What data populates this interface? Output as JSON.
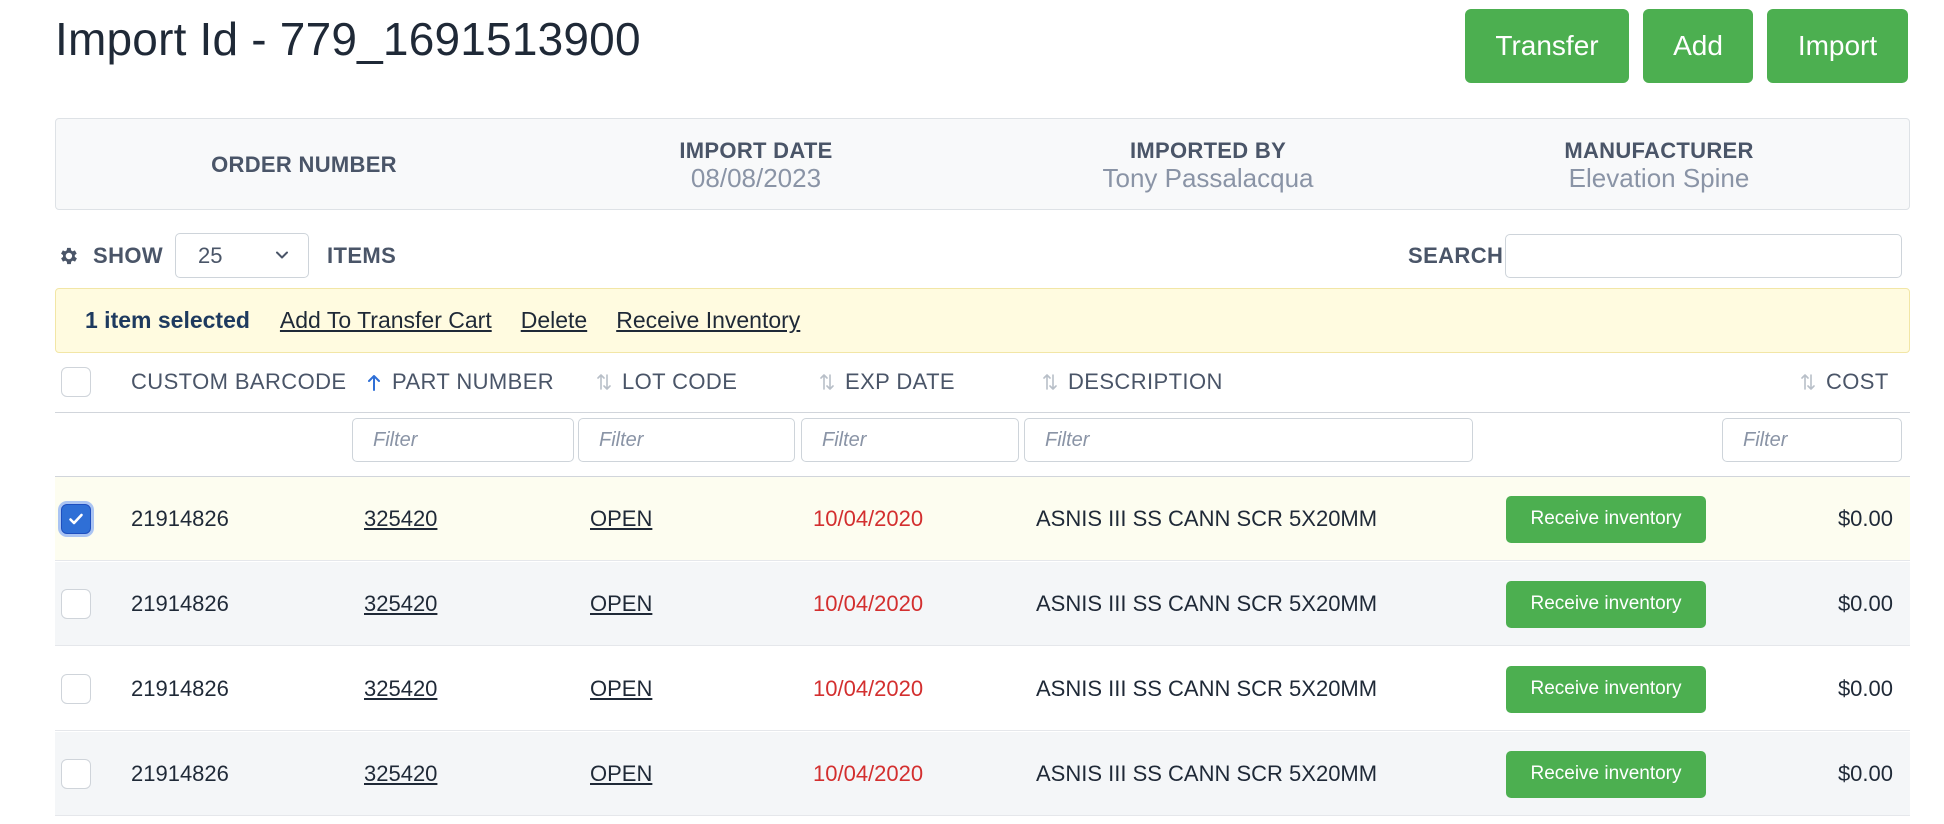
{
  "page_title": "Import Id - 779_1691513900",
  "header_buttons": {
    "transfer": "Transfer",
    "add": "Add",
    "import": "Import"
  },
  "info": {
    "order_number_label": "ORDER NUMBER",
    "import_date_label": "IMPORT DATE",
    "import_date_value": "08/08/2023",
    "imported_by_label": "IMPORTED BY",
    "imported_by_value": "Tony Passalacqua",
    "manufacturer_label": "MANUFACTURER",
    "manufacturer_value": "Elevation Spine"
  },
  "controls": {
    "show_label": "SHOW",
    "page_size": "25",
    "items_label": "ITEMS",
    "search_label": "SEARCH",
    "search_value": ""
  },
  "selection_bar": {
    "count_text": "1 item selected",
    "actions": [
      "Add To Transfer Cart",
      "Delete",
      "Receive Inventory"
    ]
  },
  "columns": {
    "custom_barcode": "CUSTOM BARCODE",
    "part_number": "PART NUMBER",
    "lot_code": "LOT CODE",
    "exp_date": "EXP DATE",
    "description": "DESCRIPTION",
    "cost": "COST"
  },
  "filter_placeholder": "Filter",
  "rows": [
    {
      "barcode": "21914826",
      "part": "325420",
      "lot": "OPEN",
      "exp": "10/04/2020",
      "desc": "ASNIS III SS CANN SCR 5X20MM",
      "action": "Receive inventory",
      "cost": "$0.00",
      "checked": true
    },
    {
      "barcode": "21914826",
      "part": "325420",
      "lot": "OPEN",
      "exp": "10/04/2020",
      "desc": "ASNIS III SS CANN SCR 5X20MM",
      "action": "Receive inventory",
      "cost": "$0.00",
      "checked": false
    },
    {
      "barcode": "21914826",
      "part": "325420",
      "lot": "OPEN",
      "exp": "10/04/2020",
      "desc": "ASNIS III SS CANN SCR 5X20MM",
      "action": "Receive inventory",
      "cost": "$0.00",
      "checked": false
    },
    {
      "barcode": "21914826",
      "part": "325420",
      "lot": "OPEN",
      "exp": "10/04/2020",
      "desc": "ASNIS III SS CANN SCR 5X20MM",
      "action": "Receive inventory",
      "cost": "$0.00",
      "checked": false
    }
  ],
  "colors": {
    "primary_green": "#4caf50",
    "selected_row_bg": "#fdfdf0",
    "striped_row_bg": "#f4f6f8",
    "date_red": "#d32f2f",
    "checkbox_blue": "#2f6fd6",
    "selection_bar_bg": "#fffbe0"
  }
}
